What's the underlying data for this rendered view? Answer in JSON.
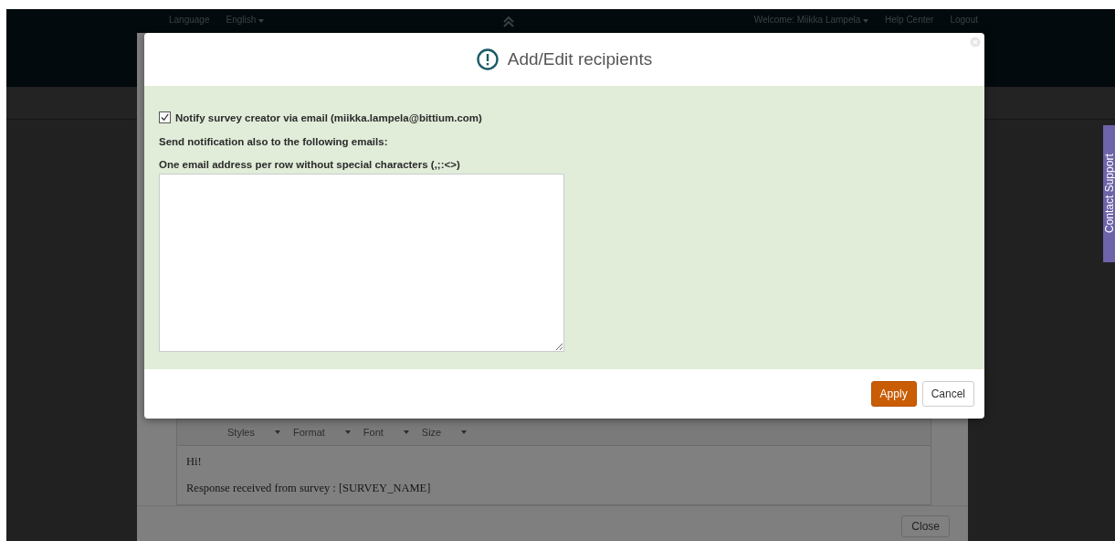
{
  "top_bar": {
    "language_label": "Language",
    "language": "English",
    "welcome": "Welcome: Miikka Lampela",
    "help": "Help Center",
    "logout": "Logout"
  },
  "contact_tab": "Contact Support",
  "background_dialog": {
    "toolbar_dropdowns": [
      "Styles",
      "Format",
      "Font",
      "Size"
    ],
    "lines": [
      "Hi!",
      "Response received from survey : [SURVEY_NAME]"
    ],
    "close_button": "Close"
  },
  "dialog": {
    "title": "Add/Edit recipients",
    "notify": {
      "label": "Notify survey creator via email (miikka.lampela@bittium.com)",
      "checked": true
    },
    "also_label": "Send notification also to the following emails:",
    "emails_label": "One email address per row without special characters (,;:<>)",
    "buttons": [
      {
        "label": "Apply",
        "kind": "primary"
      },
      {
        "label": "Cancel",
        "kind": "secondary"
      }
    ]
  }
}
